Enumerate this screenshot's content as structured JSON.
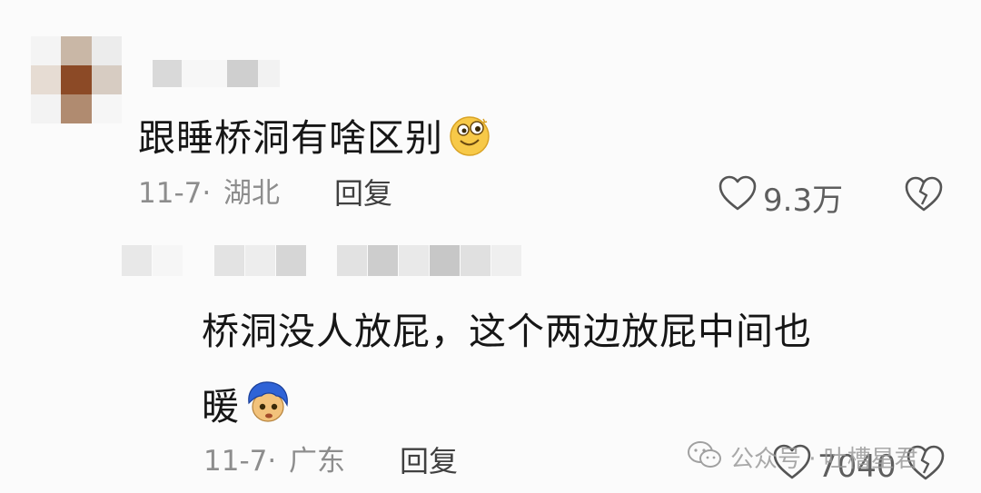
{
  "comment1": {
    "text": "跟睡桥洞有啥区别",
    "emoji": "smiling-face-emoji",
    "date": "11-7·",
    "location": "湖北",
    "reply_label": "回复",
    "like_count": "9.3万",
    "icons": {
      "like": "heart-outline-icon",
      "dislike": "broken-heart-icon"
    }
  },
  "comment2": {
    "line1": "桥洞没人放屁，这个两边放屁中间也",
    "line2": "暖",
    "emoji": "blue-hair-face-emoji",
    "date": "11-7·",
    "location": "广东",
    "reply_label": "回复",
    "like_count": "7040",
    "icons": {
      "like": "heart-outline-icon",
      "dislike": "broken-heart-icon"
    }
  },
  "watermark": {
    "text": "公众号 · 吐槽星君",
    "icon": "wechat-logo-icon"
  },
  "colors": {
    "text": "#161616",
    "meta": "#8d8d8d",
    "background": "#fbfbfb"
  }
}
